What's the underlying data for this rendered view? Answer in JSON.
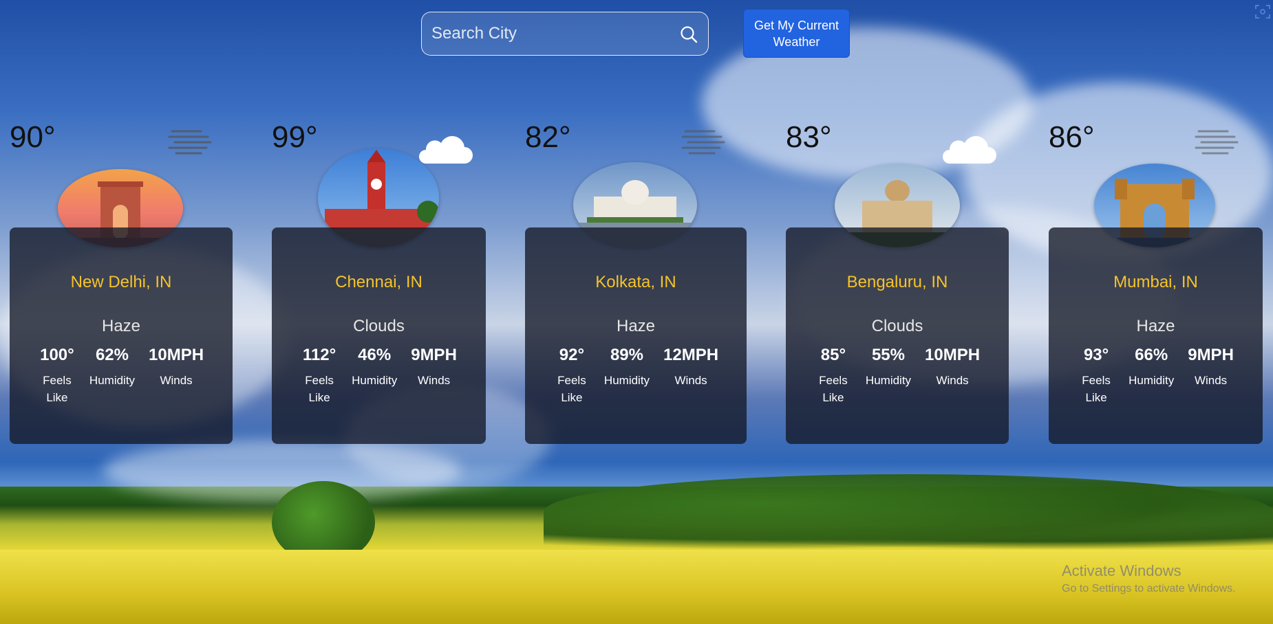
{
  "search": {
    "placeholder": "Search City"
  },
  "current_button": {
    "label": "Get My Current Weather"
  },
  "cities": [
    {
      "big_temp": "90°",
      "icon": "haze-icon",
      "photo": "india-gate",
      "name": "New Delhi, IN",
      "condition": "Haze",
      "feels": "100°",
      "humidity": "62%",
      "winds": "10MPH"
    },
    {
      "big_temp": "99°",
      "icon": "cloud-icon",
      "photo": "chennai-central",
      "name": "Chennai, IN",
      "condition": "Clouds",
      "feels": "112°",
      "humidity": "46%",
      "winds": "9MPH"
    },
    {
      "big_temp": "82°",
      "icon": "haze-icon",
      "photo": "victoria-memorial",
      "name": "Kolkata, IN",
      "condition": "Haze",
      "feels": "92°",
      "humidity": "89%",
      "winds": "12MPH"
    },
    {
      "big_temp": "83°",
      "icon": "cloud-icon",
      "photo": "vidhana-soudha",
      "name": "Bengaluru, IN",
      "condition": "Clouds",
      "feels": "85°",
      "humidity": "55%",
      "winds": "10MPH"
    },
    {
      "big_temp": "86°",
      "icon": "haze-icon",
      "photo": "gateway-of-india",
      "name": "Mumbai, IN",
      "condition": "Haze",
      "feels": "93°",
      "humidity": "66%",
      "winds": "9MPH"
    }
  ],
  "labels": {
    "feels": "Feels Like",
    "humidity": "Humidity",
    "winds": "Winds"
  },
  "watermark": {
    "title": "Activate Windows",
    "subtitle": "Go to Settings to activate Windows."
  },
  "colors": {
    "accent": "#2263e0",
    "city_name": "#f6c32b",
    "card_bg": "#14182680"
  }
}
